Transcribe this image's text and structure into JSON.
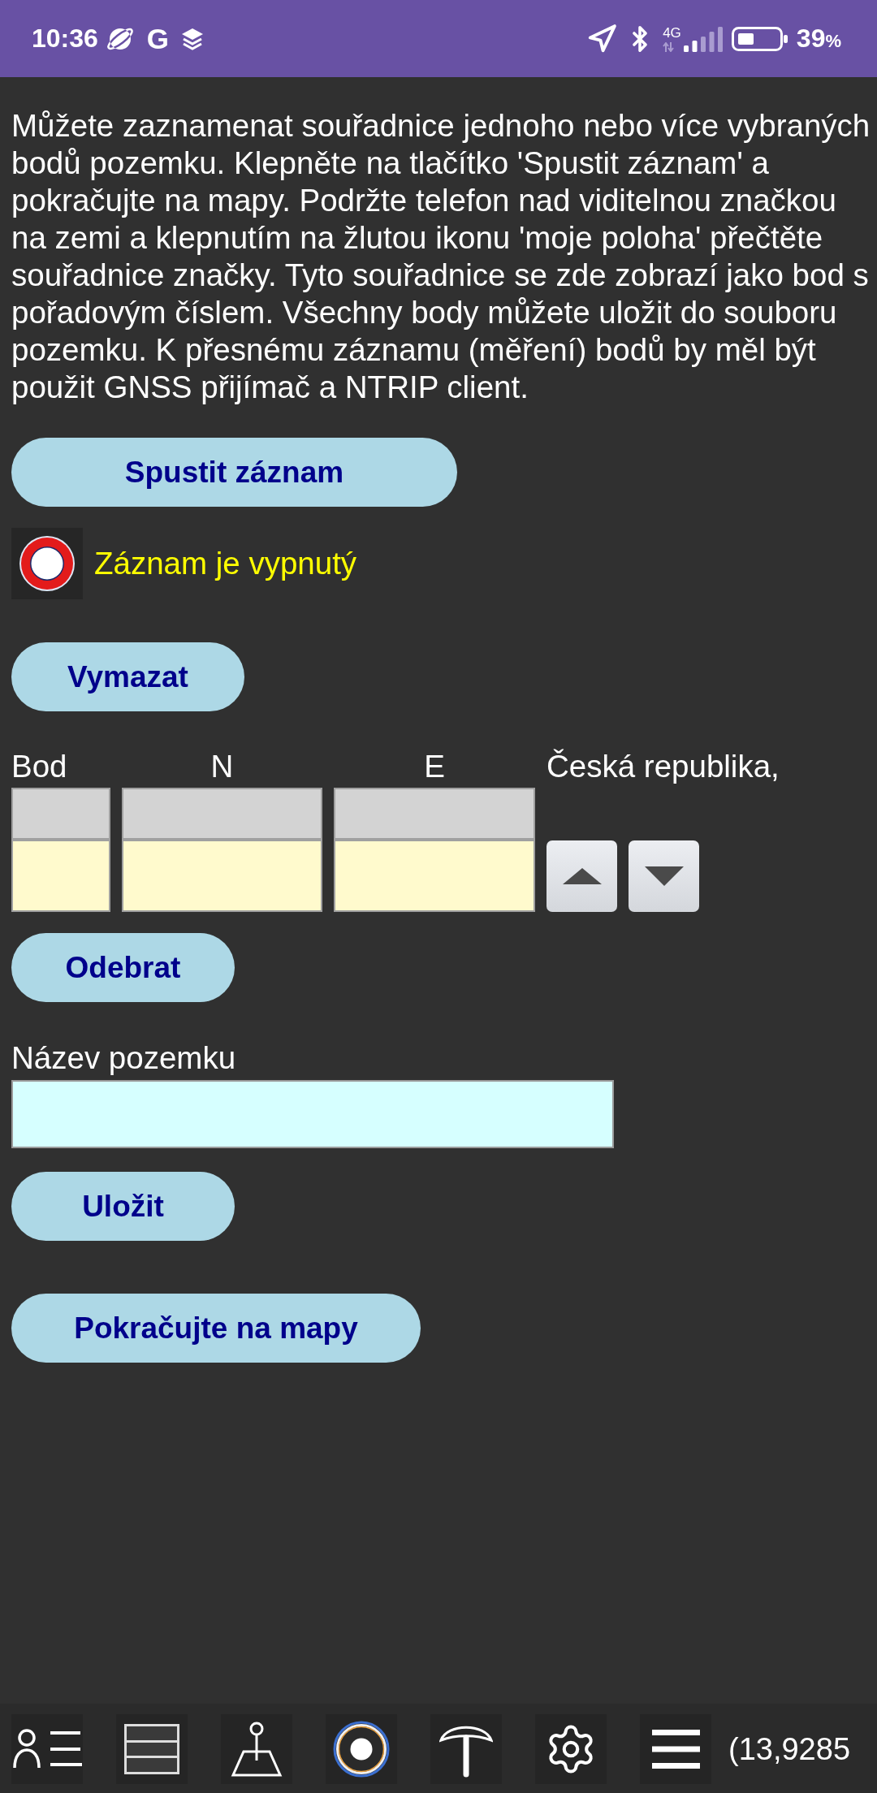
{
  "status_bar": {
    "time": "10:36",
    "notification_letter": "G",
    "network_type": "4G",
    "battery_percent": "39",
    "percent_sign": "%"
  },
  "intro": "Můžete zaznamenat souřadnice jednoho nebo více vybraných bodů pozemku. Klepněte na tlačítko 'Spustit záznam' a pokračujte na mapy. Podržte telefon nad viditelnou značkou na zemi a klepnutím na žlutou ikonu 'moje poloha' přečtěte souřadnice značky. Tyto souřadnice se zde zobrazí jako bod s pořadovým číslem. Všechny body můžete uložit do souboru pozemku. K přesnému záznamu (měření) bodů by měl být použit GNSS přijímač a NTRIP client.",
  "start_button": "Spustit záznam",
  "recording": {
    "on": false,
    "status": "Záznam je vypnutý"
  },
  "clear_button": "Vymazat",
  "points_table": {
    "columns": [
      {
        "label": "Bod"
      },
      {
        "label": "N"
      },
      {
        "label": "E"
      }
    ],
    "region": "Česká republika,"
  },
  "remove_button": "Odebrat",
  "parcel_name": {
    "label": "Název pozemku"
  },
  "save_button": "Uložit",
  "continue_button": "Pokračujte na mapy",
  "bottom_bar": {
    "coordinates": "(13,9285"
  }
}
